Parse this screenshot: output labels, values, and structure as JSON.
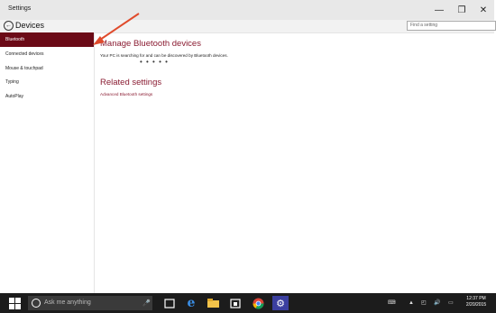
{
  "window": {
    "title": "Settings",
    "minimize_glyph": "—",
    "maximize_glyph": "❐",
    "close_glyph": "✕"
  },
  "header": {
    "back_glyph": "←",
    "page_title": "Devices",
    "search_placeholder": "Find a setting"
  },
  "sidebar": {
    "items": [
      {
        "label": "Bluetooth",
        "active": true
      },
      {
        "label": "Connected devices",
        "active": false
      },
      {
        "label": "Mouse & touchpad",
        "active": false
      },
      {
        "label": "Typing",
        "active": false
      },
      {
        "label": "AutoPlay",
        "active": false
      }
    ]
  },
  "main": {
    "heading": "Manage Bluetooth devices",
    "searching_text": "Your PC is searching for and can be discovered by Bluetooth devices.",
    "progress_dots": "• • • • •",
    "related_heading": "Related settings",
    "related_link": "Advanced Bluetooth settings"
  },
  "taskbar": {
    "search_placeholder": "Ask me anything",
    "apps": [
      "task-view-icon",
      "edge-icon",
      "file-explorer-icon",
      "store-icon",
      "chrome-icon",
      "settings-icon"
    ],
    "time": "12:37 PM",
    "date": "2/20/2015"
  },
  "colors": {
    "accent": "#8a1c32",
    "selected_nav": "#6b0a17",
    "annotation_arrow": "#e04b2c",
    "taskbar": "#1c1c1c"
  }
}
